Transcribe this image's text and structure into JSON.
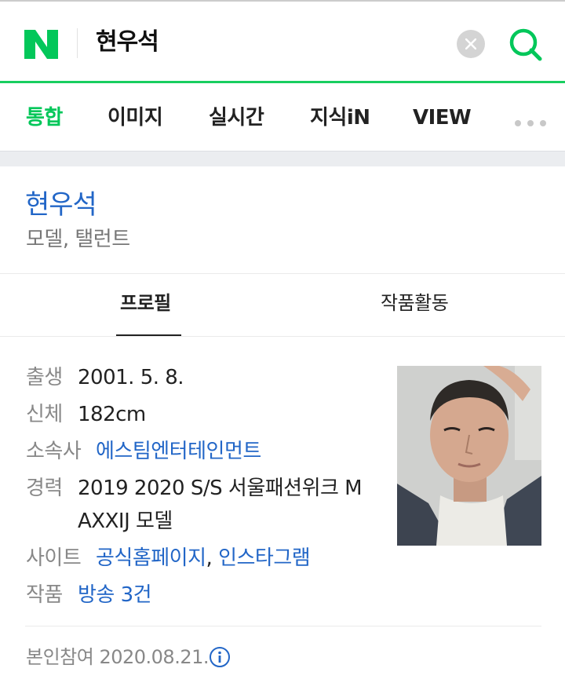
{
  "header": {
    "logo_text": "N",
    "query": "현우석",
    "clear_icon": "clear-icon",
    "search_icon": "search-icon",
    "brand_color": "#03c75a"
  },
  "tabs": {
    "items": [
      "통합",
      "이미지",
      "실시간",
      "지식iN",
      "VIEW"
    ],
    "active": "통합",
    "more_icon": "more-dots-icon"
  },
  "profile": {
    "name": "현우석",
    "job": "모델, 탤런트",
    "subtabs": [
      "프로필",
      "작품활동"
    ],
    "active_subtab": "프로필",
    "rows": {
      "birth_label": "출생",
      "birth_value": "2001. 5. 8.",
      "body_label": "신체",
      "body_value": "182cm",
      "agency_label": "소속사",
      "agency_value": "에스팀엔터테인먼트",
      "career_label": "경력",
      "career_line1": "2019 2020 S/S 서울패션위크 M",
      "career_line2": "AXXIJ 모델",
      "site_label": "사이트",
      "site_link1": "공식홈페이지",
      "site_sep": ",",
      "site_link2": "인스타그램",
      "works_label": "작품",
      "works_value": "방송 3건"
    },
    "footer": "본인참여 2020.08.21.",
    "footer_icon": "info-icon",
    "link_color": "#2266c7"
  }
}
